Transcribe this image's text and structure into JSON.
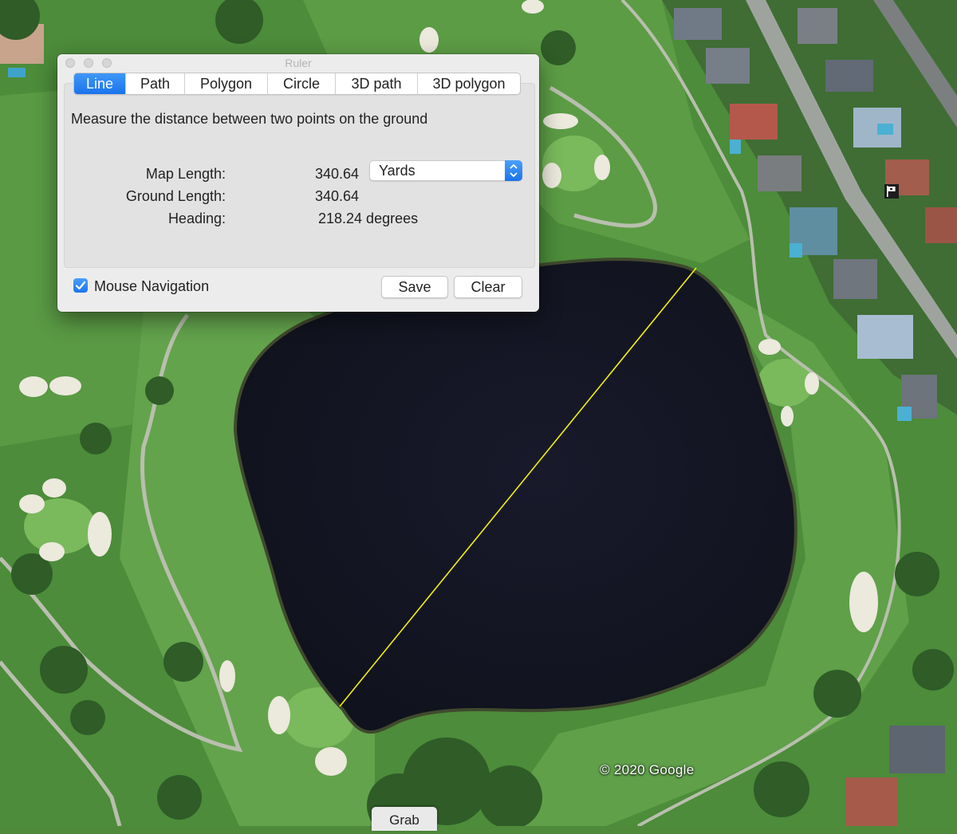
{
  "window": {
    "title": "Ruler",
    "tabs": [
      {
        "label": "Line",
        "active": true
      },
      {
        "label": "Path",
        "active": false
      },
      {
        "label": "Polygon",
        "active": false
      },
      {
        "label": "Circle",
        "active": false
      },
      {
        "label": "3D path",
        "active": false
      },
      {
        "label": "3D polygon",
        "active": false
      }
    ],
    "description": "Measure the distance between two points on the ground",
    "map_length_label": "Map Length:",
    "map_length_value": "340.64",
    "units_selected": "Yards",
    "ground_length_label": "Ground Length:",
    "ground_length_value": "340.64",
    "heading_label": "Heading:",
    "heading_value": "218.24 degrees",
    "mouse_navigation_label": "Mouse Navigation",
    "mouse_navigation_checked": true,
    "save_label": "Save",
    "clear_label": "Clear"
  },
  "map": {
    "copyright": "© 2020 Google",
    "grab_label": "Grab",
    "measure_line_color": "#f2f20a",
    "accent_color": "#1a74ec"
  }
}
